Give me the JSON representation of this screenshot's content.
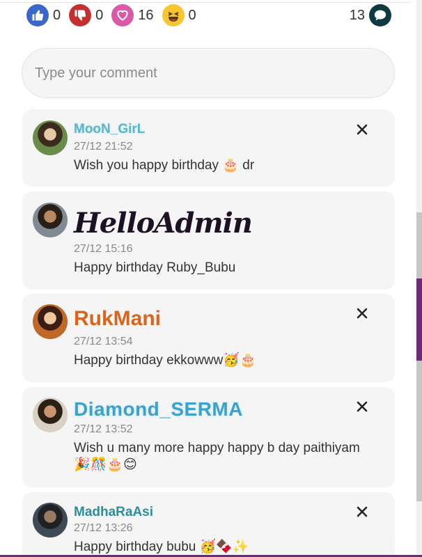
{
  "reactions": {
    "like": {
      "icon": "thumbs-up-icon",
      "count": "0",
      "color": "#3b67c9"
    },
    "dislike": {
      "icon": "thumbs-down-icon",
      "count": "0",
      "color": "#c43030"
    },
    "love": {
      "icon": "heart-icon",
      "count": "16",
      "color": "#d95aa6"
    },
    "haha": {
      "icon": "laughing-face-icon",
      "count": "0",
      "color": "#f7c631"
    },
    "comments": {
      "icon": "speech-bubble-icon",
      "count": "13",
      "color": "#0f3b40"
    }
  },
  "comment_box": {
    "placeholder": "Type your comment"
  },
  "comments": [
    {
      "username": "MooN_GirL",
      "time": "27/12 21:52",
      "text": "Wish you happy birthday 🎂 dr",
      "deletable": true
    },
    {
      "username": "HelloAdmin",
      "time": "27/12 15:16",
      "text": "Happy birthday Ruby_Bubu",
      "deletable": false
    },
    {
      "username": "RukMani",
      "time": "27/12 13:54",
      "text": "Happy birthday ekkowww🥳🎂",
      "deletable": true
    },
    {
      "username": "Diamond_SERMA",
      "time": "27/12 13:52",
      "text": "Wish u many more happy happy b day paithiyam 🎉🎊🎂😊",
      "deletable": true
    },
    {
      "username": "MadhaRaAsi",
      "time": "27/12 13:26",
      "text": "Happy birthday bubu 🥳🍫✨",
      "deletable": true
    }
  ],
  "colors": {
    "accent": "#6b2a7a",
    "card_bg": "#f5f5f5",
    "time": "#888888"
  }
}
